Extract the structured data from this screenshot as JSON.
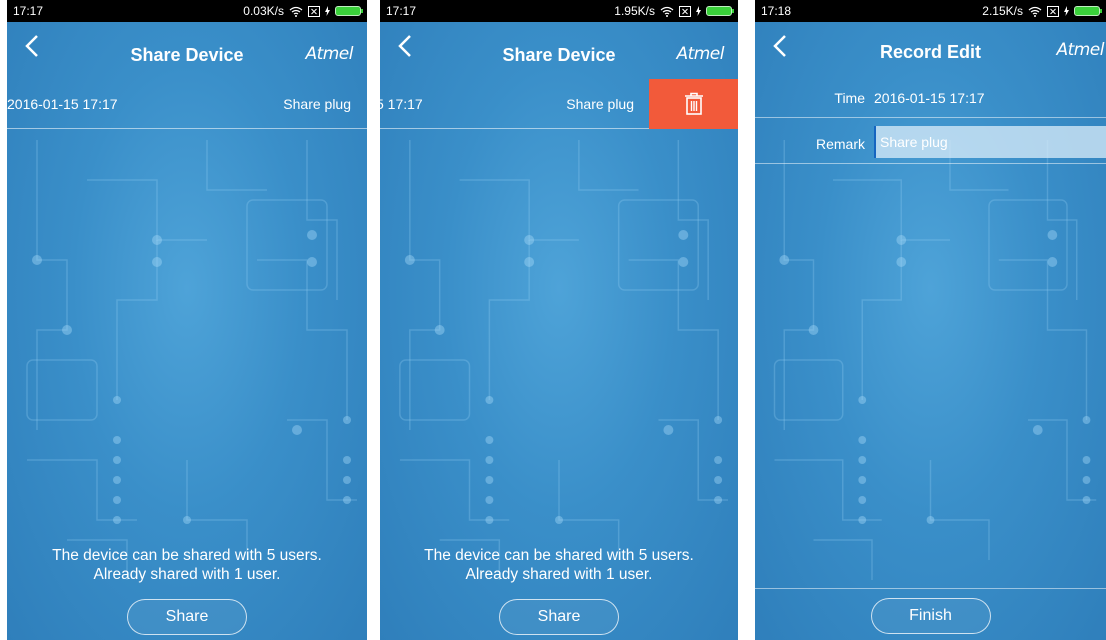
{
  "screens": [
    {
      "status": {
        "time": "17:17",
        "speed": "0.03K/s"
      },
      "title": "Share Device",
      "brand": "Atmel",
      "record": {
        "time": "2016-01-15 17:17",
        "remark": "Share plug"
      },
      "info_line1": "The device can be shared with 5 users.",
      "info_line2": "Already shared with 1 user.",
      "button": "Share"
    },
    {
      "status": {
        "time": "17:17",
        "speed": "1.95K/s"
      },
      "title": "Share Device",
      "brand": "Atmel",
      "record": {
        "time": "5 17:17",
        "remark": "Share plug"
      },
      "delete_icon": "trash-icon",
      "info_line1": "The device can be shared with 5 users.",
      "info_line2": "Already shared with 1 user.",
      "button": "Share"
    },
    {
      "status": {
        "time": "17:18",
        "speed": "2.15K/s"
      },
      "title": "Record Edit",
      "brand": "Atmel",
      "time_label": "Time",
      "time_value": "2016-01-15 17:17",
      "remark_label": "Remark",
      "remark_value": "Share plug",
      "button": "Finish"
    }
  ],
  "colors": {
    "delete": "#f25a3a",
    "background": "#3a8fc9",
    "battery": "#3ad13a"
  }
}
